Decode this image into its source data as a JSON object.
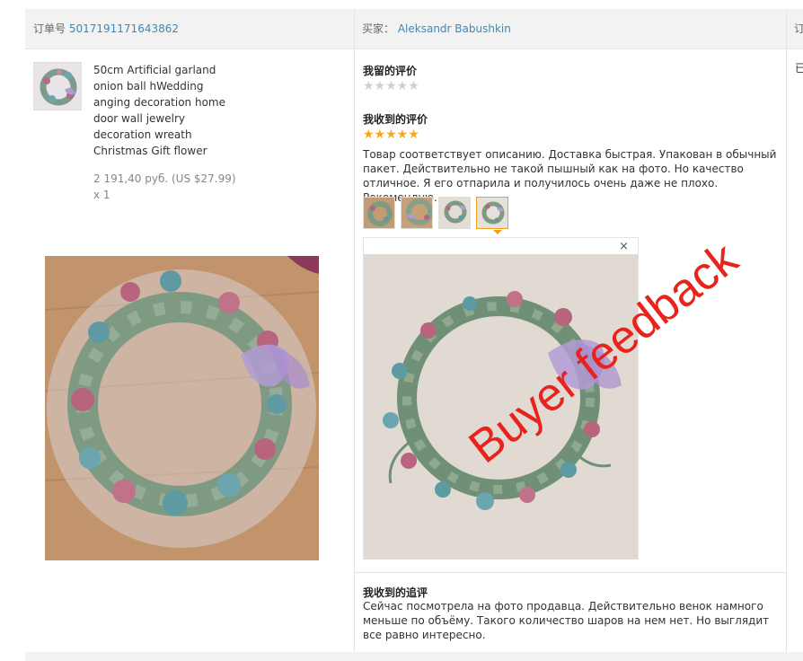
{
  "order": {
    "order_label": "订单号",
    "order_number": "5017191171643862",
    "buyer_label": "买家：",
    "buyer_name": "Aleksandr Babushkin",
    "edge_header": "订",
    "edge_status": "已"
  },
  "product": {
    "title": "50cm Artificial garland onion ball hWedding anging decoration home door wall jewelry decoration wreath Christmas Gift flower",
    "price": "2 191,40 руб. (US $27.99)",
    "quantity": "x 1"
  },
  "my_review": {
    "title": "我留的评价",
    "stars": "★★★★★",
    "rating": 0
  },
  "received_review": {
    "title": "我收到的评价",
    "stars": "★★★★★",
    "rating": 5,
    "text": "Товар соответствует описанию. Доставка быстрая. Упакован в обычный пакет. Действительно не такой пышный как на фото. Но качество отличное. Я его отпарила и получилось очень даже не плохо. Рекомендую.",
    "thumbnail_count": 4,
    "active_thumbnail": 4,
    "close_glyph": "×"
  },
  "followup": {
    "title": "我收到的追评",
    "text": "Сейчас посмотрела на фото продавца. Действительно венок намного меньше по объёму. Такого количество шаров на нем нет. Но выглядит все равно интересно."
  },
  "watermark": "Buyer feedback",
  "colors": {
    "link": "#3a8ab8",
    "star_full": "#f5a623",
    "star_empty": "#cfcfcf",
    "watermark": "#e8231b",
    "active_thumb_border": "#f0a020"
  }
}
